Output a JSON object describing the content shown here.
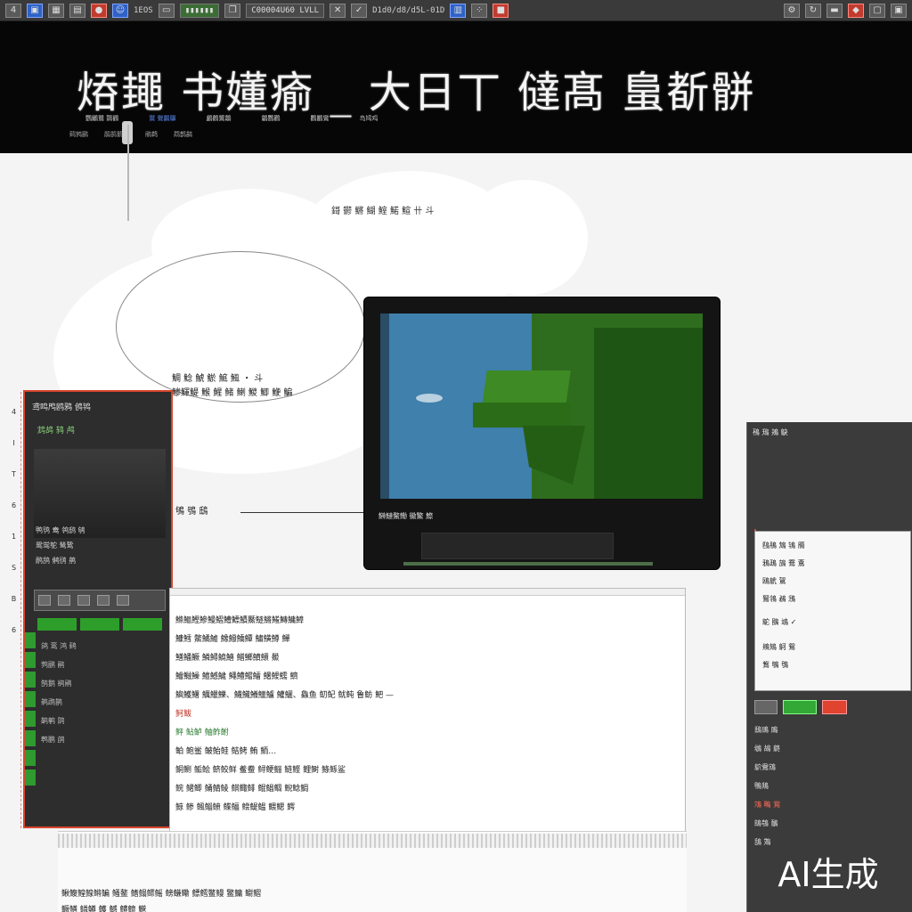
{
  "toolbar": {
    "items": [
      "4",
      "1EOS",
      "C00004U60 LVLL",
      "D1d0/d8/d5L-01D"
    ]
  },
  "banner": {
    "title": "㶺䵷 书嬞瘉 _ 大日丅 㒓髙 蛗斱骿",
    "nav": [
      "鸚鸍鸎 鸏鸐",
      "鸑 鸒鸓鸔",
      "鸕鸖鸗鸘",
      "鸙鸚鸛",
      "鸜鸝鸞",
      "鸟鸠鸡"
    ],
    "sub": [
      "鹀鹁鹂",
      "鹃鹄鹅鹆",
      "鹇鹈",
      "鹉鹊鹋"
    ]
  },
  "captions": {
    "top": "鎶 鬰 鱂 鰗 鰘 鰙 鰚 卄 斗",
    "left1": "鯛 鯰 鯱 鯲 鯳 鯴 ・ 斗",
    "left2": "鯵鯶鯷 鯸 鯹 鯺 鯻 鯼 鯽 鯾 鯿",
    "left3": "鴝 鴞 鴟"
  },
  "monitor": {
    "label": "鰰鰱鰲鰳 鰴鰵 鰶"
  },
  "left_panel": {
    "head": "鸢鸣鸤鸥鸦 鸧鸨",
    "sub": "鸩鸪 鸫 鸬",
    "list": [
      "鸭鸮 鸯 鸰鸱 鸲",
      "鸳鸴鸵 鸶鸷",
      "鸸鸹 鸺鸻 鸼"
    ],
    "rows": [
      "鸽 鸾 鸿 鹀",
      "鹁鹂 鹃",
      "鹄鹅 鹆鹇",
      "鹈鹉鹊",
      "鹋鹌 鹍",
      "鹎鹏 鹐"
    ]
  },
  "ruler": [
    "4",
    "I",
    "T",
    "6",
    "1",
    "S",
    "B",
    "6"
  ],
  "document": {
    "lines": [
      "鰷鰸鰹鰺鰻鰼鰽鰾鰿鱀鱁鱂鱃鱄鱅鱆",
      "鱇鱈 鱉鱊鱋 鱌鱍鱎鱏 鱐鱑鱒 鱓",
      "鱔鱕鱖 鱗鱘鱙鱚 鱛鱜鱝鱞 鱟",
      "鱠鱡鱢 鱣鱤鱥 鱦鱧鱨鱩 鱪鱫鱬 鱭",
      "鱮鱯鱰 鱱鱲鱳、鱴鱵鱶鱷鱸 鱹鱺、鱻鱼 鱽鱾 鱿鲀 鲁鲂 鲃 —",
      "鲄鲅",
      "鲆 鲇鲈 鲉鲊鲋",
      "鲌 鲍鲎 鲏鲐鲑 鲒鲓 鲔 鲕…",
      "鲖鲗 鲘鲙 鲚鲛鲜 鲝鲞 鲟鲠鲡 鲢鲣 鲤鲥 鲦鲧鲨",
      "鲩 鲪鲫 鲬鲭鲮 鲯鲰鲱 鲲鲳鲴 鲵鲶鲷",
      "鲸 鲹 鲺鲻鲼 鲽鲾 鲿鳀鳁 鳂鳃 鳄"
    ],
    "foot1": "鳅鳆鳇鳈鳉鳊 鳋鳌 鳍鳎鳏鳐 鳑鳒鳓 鳔鳕鳖鳗 鳘鳙 鳚鳛",
    "foot2": "鳜鳝 鳞鳟 鳠 鳡 鳢鳣 鳤"
  },
  "right_panel": {
    "head": "鴀 鴁 鴂 鴃",
    "dialog": [
      "鴄鴅 鴆 鴇 鴈",
      "鴉鴊 鴋 鴌 鴍",
      "鴎鴏 鴐",
      "鴑鴒 鴓 鴔",
      "鴕 鴖 鴗 ✓",
      "鴘鴙 鴚 鴛",
      "鴜 鴝 鴞"
    ],
    "list": [
      "鴟鴠 鴡",
      "鴢 鴣 鴤",
      "鴥鴦鴧",
      "鴨鴩",
      "鴪 鴫 鴬",
      "鴭鴮 鴯",
      "鴰 鴱"
    ]
  },
  "badge": {
    "text": "AI生成"
  },
  "colors": {
    "accent_red": "#d8452e",
    "accent_green": "#2e9e2b",
    "screen_blue": "#3f80ac"
  }
}
